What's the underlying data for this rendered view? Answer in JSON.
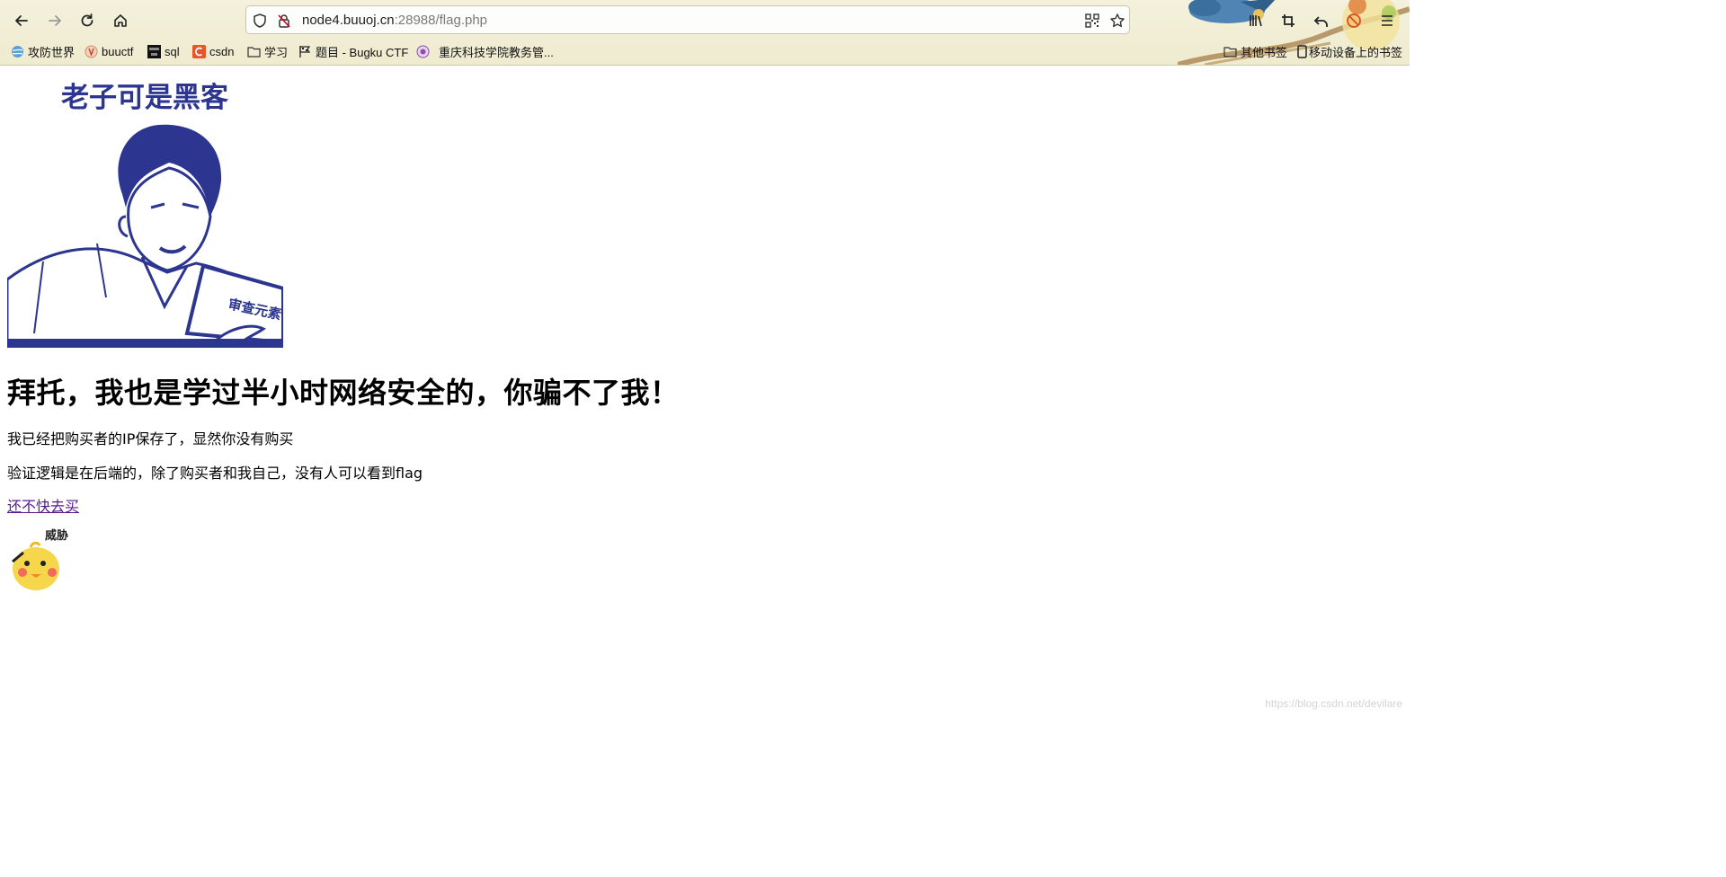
{
  "browser": {
    "url_host": "node4.buuoj.cn",
    "url_port_path": ":28988/flag.php",
    "bookmarks": [
      {
        "label": "攻防世界",
        "icon": "globe-icon"
      },
      {
        "label": "buuctf",
        "icon": "buuctf-icon"
      },
      {
        "label": "sql",
        "icon": "hackit-icon"
      },
      {
        "label": "csdn",
        "icon": "csdn-icon"
      },
      {
        "label": "学习",
        "icon": "folder-icon"
      },
      {
        "label": "题目 - Bugku CTF",
        "icon": "flag-icon"
      },
      {
        "label": "重庆科技学院教务管...",
        "icon": "school-icon"
      }
    ],
    "other_bookmarks": "其他书签",
    "mobile_bookmarks": "移动设备上的书签"
  },
  "page": {
    "image_caption": "老子可是黑客",
    "heading": "拜托，我也是学过半小时网络安全的，你骗不了我！",
    "line1": "我已经把购买者的IP保存了，显然你没有购买",
    "line2": "验证逻辑是在后端的，除了购买者和我自己，没有人可以看到flag",
    "buy_link": "还不快去买",
    "sticker_caption": "威胁"
  },
  "watermark": "https://blog.csdn.net/devilare"
}
